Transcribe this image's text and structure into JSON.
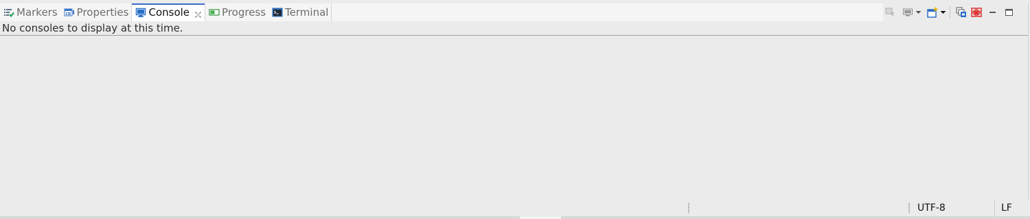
{
  "tabs": [
    {
      "label": "Markers",
      "icon": "markers-icon",
      "active": false
    },
    {
      "label": "Properties",
      "icon": "properties-icon",
      "active": false
    },
    {
      "label": "Console",
      "icon": "console-icon",
      "active": true,
      "closable": true
    },
    {
      "label": "Progress",
      "icon": "progress-icon",
      "active": false
    },
    {
      "label": "Terminal",
      "icon": "terminal-icon",
      "active": false
    }
  ],
  "toolbar": {
    "items": [
      "pin-console-icon",
      "display-selected-console-icon",
      "open-console-icon",
      "view-menu-icon",
      "minimize-icon",
      "maximize-icon"
    ]
  },
  "console": {
    "message": "No consoles to display at this time."
  },
  "statusbar": {
    "encoding": "UTF-8",
    "line_delimiter": "LF"
  },
  "colors": {
    "accent": "#3b6cc7",
    "background": "#ebebeb",
    "tab_bar": "#f5f5f5"
  }
}
